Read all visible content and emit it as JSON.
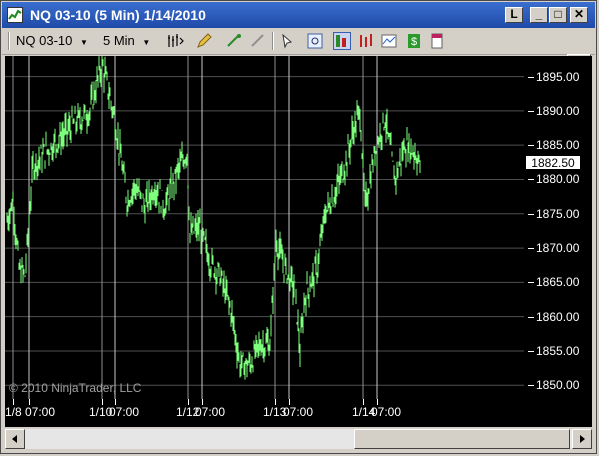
{
  "window": {
    "title": "NQ 03-10 (5 Min)  1/14/2010",
    "buttons": {
      "link": "L",
      "minimize": "_",
      "maximize": "□",
      "close": "✕"
    }
  },
  "toolbar": {
    "instrument": "NQ 03-10",
    "interval": "5 Min",
    "icons": [
      "bar-type-icon",
      "pencil-icon",
      "crosshair-icon",
      "zoom-out-icon",
      "cursor-icon",
      "magnify-icon",
      "data-box-icon",
      "chart-properties-icon",
      "indicators-icon",
      "strategies-icon",
      "order-bar-icon"
    ]
  },
  "chart": {
    "copyright": "© 2010 NinjaTrader, LLC",
    "last_price": "1882.50",
    "y_labels": [
      "1895.00",
      "1890.00",
      "1885.00",
      "1880.00",
      "1875.00",
      "1870.00",
      "1865.00",
      "1860.00",
      "1855.00",
      "1850.00"
    ],
    "x_labels": [
      "1/8",
      "07:00",
      "1/10",
      "07:00",
      "1/12",
      "07:00",
      "1/13",
      "07:00",
      "1/14",
      "07:00"
    ],
    "colors": {
      "background": "#000000",
      "bars": "#7dff7d",
      "grid": "#c0c0c0"
    }
  },
  "chart_data": {
    "type": "line",
    "x": [
      "1/8",
      "1/8 07:00",
      "1/10",
      "1/10 07:00",
      "1/12",
      "1/12 07:00",
      "1/13",
      "1/13 07:00",
      "1/14",
      "1/14 07:00"
    ],
    "series": [
      {
        "values": [
          1876,
          1878,
          1895,
          1880,
          1878,
          1858,
          1850,
          1868,
          1880,
          1883
        ]
      }
    ],
    "ylim": [
      1848,
      1898
    ],
    "grid": true
  }
}
